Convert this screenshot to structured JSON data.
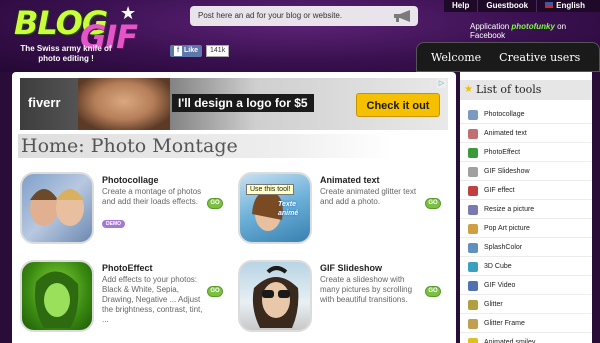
{
  "logo": {
    "word1": "BLOG",
    "word2": "GIF",
    "star": "★"
  },
  "tagline": "The Swiss army knife of photo editing !",
  "post_ad": "Post here an ad for your blog or website.",
  "facebook_like": {
    "label": "Like",
    "count": "141k"
  },
  "top_links": {
    "help": "Help",
    "guestbook": "Guestbook",
    "language": "English"
  },
  "fb_app": {
    "prefix": "Application",
    "brand": "photofunky",
    "suffix": "on Facebook"
  },
  "tabs": {
    "welcome": "Welcome",
    "creative": "Creative users"
  },
  "banner": {
    "brand": "fiverr",
    "headline": "I'll design a logo for $5",
    "cta": "Check it out"
  },
  "page_title": "Home: Photo Montage",
  "tools": [
    {
      "name": "Photocollage",
      "desc": "Create a montage of photos and add their loads effects.",
      "go": "GO",
      "badge": "DEMO"
    },
    {
      "name": "Animated text",
      "desc": "Create animated glitter text and add a photo.",
      "go": "GO",
      "tooltip": "Use this tool!",
      "thumb_text": "Texte animé"
    },
    {
      "name": "PhotoEffect",
      "desc": "Add effects to your photos: Black & White, Sepia, Drawing, Negative ... Adjust the brightness, contrast, tint, ...",
      "go": "GO"
    },
    {
      "name": "GIF Slideshow",
      "desc": "Create a slideshow with many pictures by scrolling with beautiful transitions.",
      "go": "GO"
    }
  ],
  "sidebar": {
    "title": "List of tools",
    "items": [
      {
        "label": "Photocollage",
        "color": "#7a9ac0"
      },
      {
        "label": "Animated text",
        "color": "#c07070"
      },
      {
        "label": "PhotoEffect",
        "color": "#3a9a3a"
      },
      {
        "label": "GIF Slideshow",
        "color": "#a0a0a0"
      },
      {
        "label": "GIF effect",
        "color": "#c04040"
      },
      {
        "label": "Resize a picture",
        "color": "#7a7ab0"
      },
      {
        "label": "Pop Art picture",
        "color": "#d0a040"
      },
      {
        "label": "SplashColor",
        "color": "#6090c0"
      },
      {
        "label": "3D Cube",
        "color": "#3aa0c0"
      },
      {
        "label": "GIF Video",
        "color": "#5070b0"
      },
      {
        "label": "Glitter",
        "color": "#b0a040"
      },
      {
        "label": "Glitter Frame",
        "color": "#c0a050"
      },
      {
        "label": "Animated smiley",
        "color": "#e0c020"
      }
    ]
  }
}
